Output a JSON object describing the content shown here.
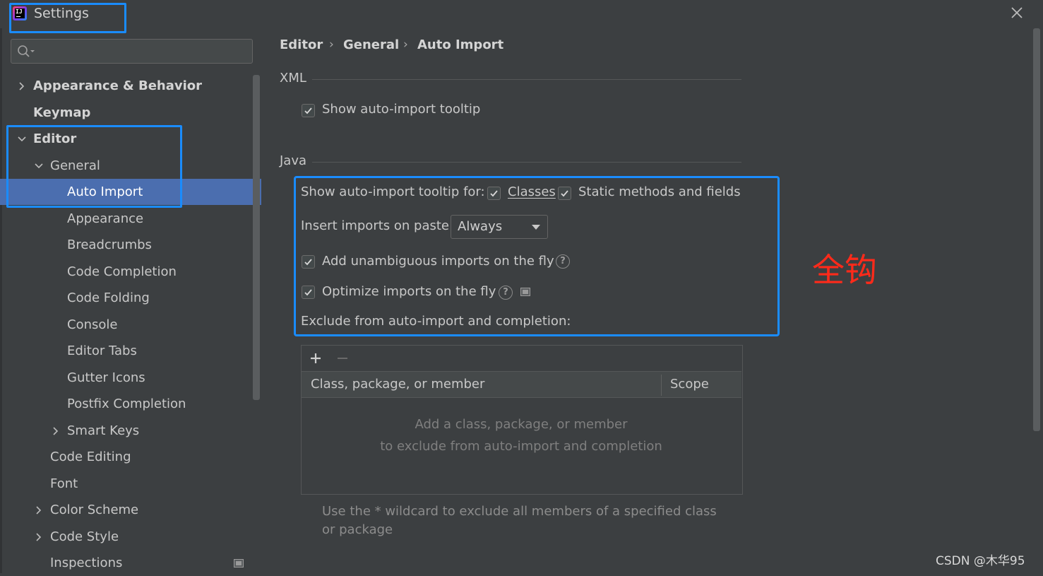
{
  "window": {
    "title": "Settings",
    "close_icon": "close-icon"
  },
  "sidebar": {
    "search": {
      "placeholder": "",
      "icon": "search-icon"
    },
    "items": [
      {
        "label": "Appearance & Behavior",
        "level": 0,
        "arrow": "right",
        "bold": true
      },
      {
        "label": "Keymap",
        "level": 0,
        "arrow": "none",
        "bold": true
      },
      {
        "label": "Editor",
        "level": 0,
        "arrow": "down",
        "bold": true
      },
      {
        "label": "General",
        "level": 1,
        "arrow": "down",
        "bold": false
      },
      {
        "label": "Auto Import",
        "level": 2,
        "arrow": "none",
        "bold": false,
        "selected": true
      },
      {
        "label": "Appearance",
        "level": 2,
        "arrow": "none",
        "bold": false
      },
      {
        "label": "Breadcrumbs",
        "level": 2,
        "arrow": "none",
        "bold": false
      },
      {
        "label": "Code Completion",
        "level": 2,
        "arrow": "none",
        "bold": false
      },
      {
        "label": "Code Folding",
        "level": 2,
        "arrow": "none",
        "bold": false
      },
      {
        "label": "Console",
        "level": 2,
        "arrow": "none",
        "bold": false
      },
      {
        "label": "Editor Tabs",
        "level": 2,
        "arrow": "none",
        "bold": false
      },
      {
        "label": "Gutter Icons",
        "level": 2,
        "arrow": "none",
        "bold": false
      },
      {
        "label": "Postfix Completion",
        "level": 2,
        "arrow": "none",
        "bold": false
      },
      {
        "label": "Smart Keys",
        "level": 2,
        "arrow": "right",
        "bold": false
      },
      {
        "label": "Code Editing",
        "level": 1,
        "arrow": "none",
        "bold": false
      },
      {
        "label": "Font",
        "level": 1,
        "arrow": "none",
        "bold": false
      },
      {
        "label": "Color Scheme",
        "level": 1,
        "arrow": "right",
        "bold": false
      },
      {
        "label": "Code Style",
        "level": 1,
        "arrow": "right",
        "bold": false
      },
      {
        "label": "Inspections",
        "level": 1,
        "arrow": "none",
        "bold": false,
        "trailing_icon": "project-settings-icon"
      }
    ]
  },
  "breadcrumb": [
    "Editor",
    "General",
    "Auto Import"
  ],
  "xml": {
    "title": "XML",
    "show_tooltip": {
      "label": "Show auto-import tooltip",
      "checked": true
    }
  },
  "java": {
    "title": "Java",
    "tooltip_for_label": "Show auto-import tooltip for:",
    "classes": {
      "label": "Classes",
      "checked": true
    },
    "static": {
      "label": "Static methods and fields",
      "checked": true
    },
    "insert_label": "Insert imports on paste:",
    "insert_value": "Always",
    "unambiguous": {
      "label": "Add unambiguous imports on the fly",
      "checked": true
    },
    "optimize": {
      "label": "Optimize imports on the fly",
      "checked": true
    },
    "exclude_label": "Exclude from auto-import and completion:"
  },
  "exclude_table": {
    "add_icon": "plus-icon",
    "remove_icon": "minus-icon",
    "columns": [
      "Class, package, or member",
      "Scope"
    ],
    "empty_line1": "Add a class, package, or member",
    "empty_line2": "to exclude from auto-import and completion"
  },
  "hint": "Use the * wildcard to exclude all members of a specified class or package",
  "annotation": "全钩",
  "watermark": "CSDN @木华95",
  "colors": {
    "accent": "#4b6eaf",
    "highlight": "#1a8cff",
    "annotation": "#ff2a1a",
    "background": "#3c3f41"
  }
}
